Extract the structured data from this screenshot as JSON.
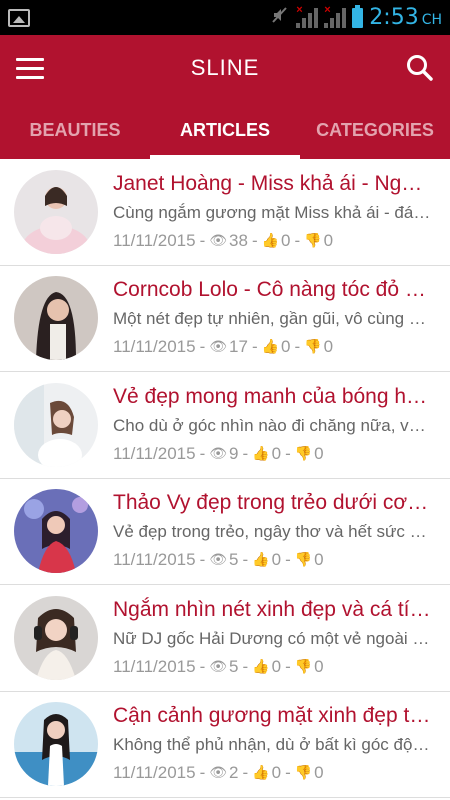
{
  "status_bar": {
    "time": "2:53",
    "time_suffix": "CH",
    "icons": [
      "gallery-icon",
      "mute-icon",
      "signal-icon",
      "signal-icon",
      "battery-icon"
    ]
  },
  "app_bar": {
    "title": "SLINE"
  },
  "tabs": [
    {
      "label": "BEAUTIES",
      "active": false
    },
    {
      "label": "ARTICLES",
      "active": true
    },
    {
      "label": "CATEGORIES",
      "active": false
    }
  ],
  "colors": {
    "primary": "#b1122f",
    "tab_inactive": "#e3a3ae",
    "status_accent": "#33b5e5"
  },
  "articles": [
    {
      "title": "Janet Hoàng - Miss khả ái - Ngưỡng mộ",
      "excerpt": "Cùng ngắm gương mặt Miss khả ái - đáng yêu",
      "date": "11/11/2015",
      "views": "38",
      "likes": "0",
      "dislikes": "0"
    },
    {
      "title": "Corncob Lolo - Cô nàng tóc đỏ xinh đẹp",
      "excerpt": "Một nét đẹp tự nhiên, gần gũi, vô cùng cuốn hút",
      "date": "11/11/2015",
      "views": "17",
      "likes": "0",
      "dislikes": "0"
    },
    {
      "title": "Vẻ đẹp mong manh của bóng hồng",
      "excerpt": "Cho dù ở góc nhìn nào đi chăng nữa, vẫn đẹp",
      "date": "11/11/2015",
      "views": "9",
      "likes": "0",
      "dislikes": "0"
    },
    {
      "title": "Thảo Vy đẹp trong trẻo dưới cơn mưa",
      "excerpt": "Vẻ đẹp trong trẻo, ngây thơ và hết sức dễ thương",
      "date": "11/11/2015",
      "views": "5",
      "likes": "0",
      "dislikes": "0"
    },
    {
      "title": "Ngắm nhìn nét xinh đẹp và cá tính",
      "excerpt": "Nữ DJ gốc Hải Dương có một vẻ ngoài nổi bật",
      "date": "11/11/2015",
      "views": "5",
      "likes": "0",
      "dislikes": "0"
    },
    {
      "title": "Cận cảnh gương mặt xinh đẹp tựa thiên thần",
      "excerpt": "Không thể phủ nhận, dù ở bất kì góc độ nào",
      "date": "11/11/2015",
      "views": "2",
      "likes": "0",
      "dislikes": "0"
    }
  ]
}
